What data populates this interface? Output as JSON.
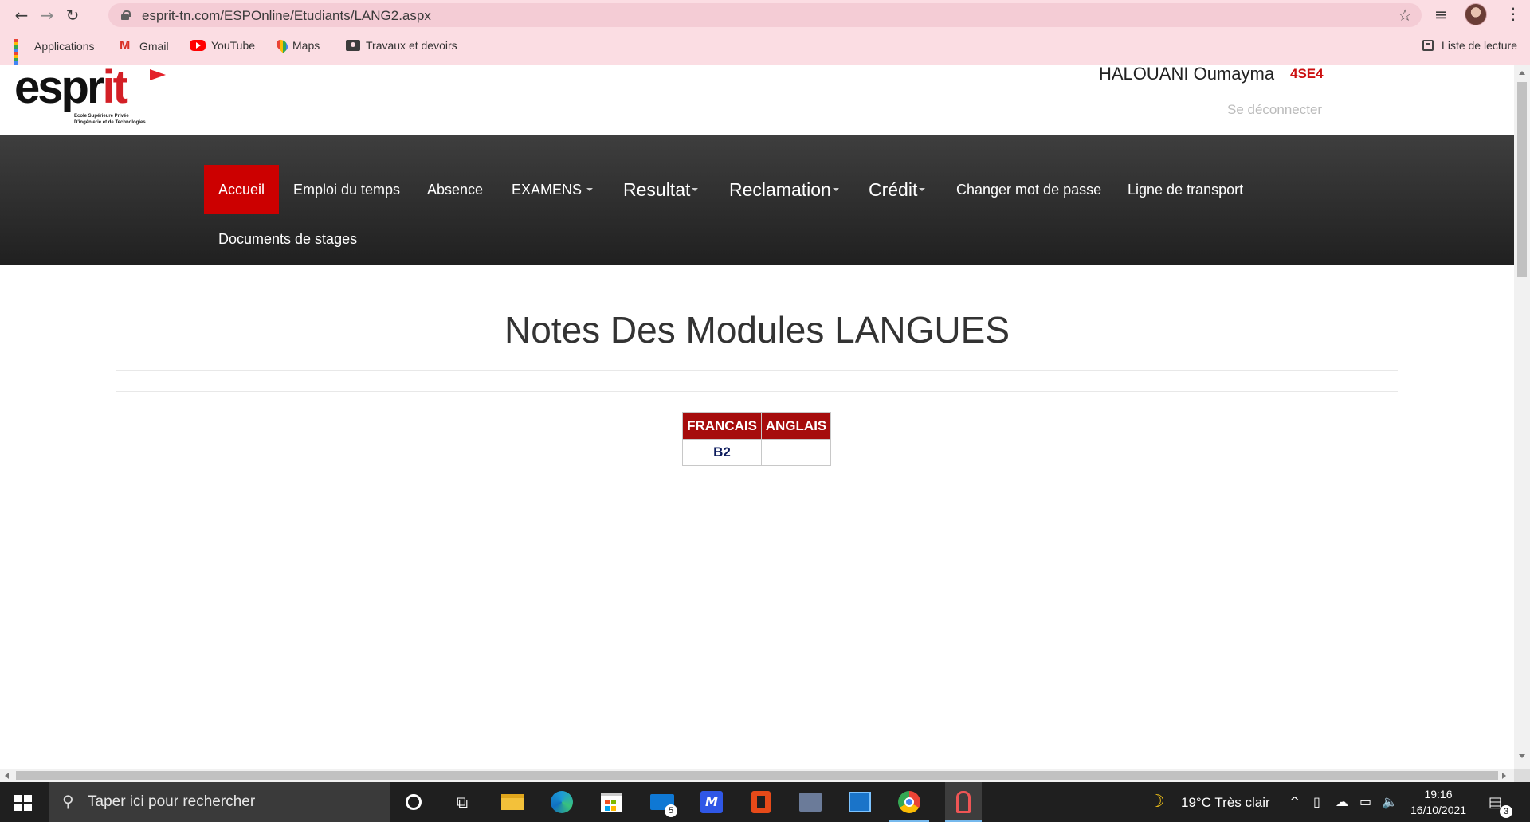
{
  "browser": {
    "url": "esprit-tn.com/ESPOnline/Etudiants/LANG2.aspx",
    "icons": {
      "back": "arrow-left-icon",
      "forward": "arrow-right-icon",
      "reload": "reload-icon",
      "lock": "lock-icon",
      "bookmark": "star-icon",
      "media": "media-control-icon",
      "profile": "profile-avatar",
      "menu": "kebab-menu-icon"
    },
    "bookmarks": [
      {
        "label": "Applications",
        "icon": "apps-grid-icon"
      },
      {
        "label": "Gmail",
        "icon": "gmail-icon"
      },
      {
        "label": "YouTube",
        "icon": "youtube-icon"
      },
      {
        "label": "Maps",
        "icon": "maps-pin-icon"
      },
      {
        "label": "Travaux et devoirs",
        "icon": "classroom-icon"
      }
    ],
    "reading_list": "Liste de lecture",
    "theme_color": "#fbdde3"
  },
  "site": {
    "logo_text_left": "espr",
    "logo_text_right": "it",
    "logo_sub_1": "Ecole Supérieure Privée",
    "logo_sub_2": "D'ingénierie et de Technologies",
    "student_name": "HALOUANI Oumayma",
    "student_class": "4SE4",
    "logout": "Se déconnecter",
    "nav": [
      {
        "label": "Accueil",
        "active": true
      },
      {
        "label": "Emploi du temps"
      },
      {
        "label": "Absence"
      },
      {
        "label": "EXAMENS",
        "dropdown": true
      },
      {
        "label": "Resultat",
        "dropdown": true
      },
      {
        "label": "Reclamation",
        "dropdown": true
      },
      {
        "label": "Crédit",
        "dropdown": true
      },
      {
        "label": "Changer mot de passe"
      },
      {
        "label": "Ligne de transport"
      },
      {
        "label": "Documents de stages"
      }
    ],
    "accent_color": "#cc0000",
    "table_header_color": "#a60c0c"
  },
  "main": {
    "title": "Notes Des Modules LANGUES",
    "table": {
      "headers": [
        "FRANCAIS",
        "ANGLAIS"
      ],
      "rows": [
        [
          "B2",
          ""
        ]
      ]
    }
  },
  "taskbar": {
    "search_placeholder": "Taper ici pour rechercher",
    "apps": [
      "cortana-icon",
      "task-view-icon",
      "file-explorer-icon",
      "edge-icon",
      "store-icon",
      "mail-icon",
      "app-icon",
      "office-icon",
      "sql-app-icon",
      "remote-app-icon",
      "chrome-icon",
      "snipping-icon"
    ],
    "mail_badge": "5",
    "weather": "19°C  Très clair",
    "time": "19:16",
    "date": "16/10/2021",
    "notifications": "3"
  }
}
